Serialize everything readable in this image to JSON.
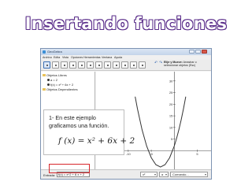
{
  "slide": {
    "title": "Insertando funciones",
    "title_outline_color": "#5a2d8a"
  },
  "window": {
    "title": "GeoGebra",
    "menu": [
      "Archivo",
      "Edita",
      "Vista",
      "Opciones",
      "Herramientas",
      "Ventana",
      "Ayuda"
    ],
    "tool_help": {
      "name": "Elije y Mueve:",
      "text": "Arrastrar o seleccionar objetos (Esc)"
    }
  },
  "algebra_view": {
    "rows": [
      {
        "text": "Objetos Libres",
        "type": "folder"
      },
      {
        "text": "a = 2",
        "type": "item"
      },
      {
        "text": "f(x) = x² + 6x + 2",
        "type": "item"
      },
      {
        "text": "Objetos Dependientes",
        "type": "folder"
      }
    ]
  },
  "graphics_view": {
    "y_ticks": [
      "30",
      "25",
      "20",
      "15",
      "10",
      "5"
    ],
    "x_ticks": [
      "-10",
      "-5",
      "5"
    ]
  },
  "chart_data": {
    "type": "line",
    "title": "",
    "function": "f(x) = x² + 6x + 2",
    "x": [
      -8.5,
      -8,
      -7,
      -6,
      -5,
      -4,
      -3,
      -2,
      -1,
      0,
      0.5,
      1,
      1.5,
      2,
      2.5
    ],
    "values": [
      23.25,
      18,
      9,
      2,
      -3,
      -6,
      -7,
      -6,
      -3,
      2,
      5.25,
      9,
      13.25,
      18,
      23.25
    ],
    "xlim": [
      -17,
      8
    ],
    "ylim": [
      -8,
      34
    ],
    "curve_color": "#333333",
    "grid": false
  },
  "input_bar": {
    "label": "Entrada:",
    "value": "f(x) = x^2 + 6 x + 2",
    "combo1": "x²",
    "combo2": "α",
    "command": "Comando..."
  },
  "callout": {
    "text": "1-  En este ejemplo graficamos una función.",
    "formula": "f (x) = x² + 6x + 2"
  },
  "colors": {
    "highlight": "#d7262b",
    "window_border": "#7d93b2"
  }
}
